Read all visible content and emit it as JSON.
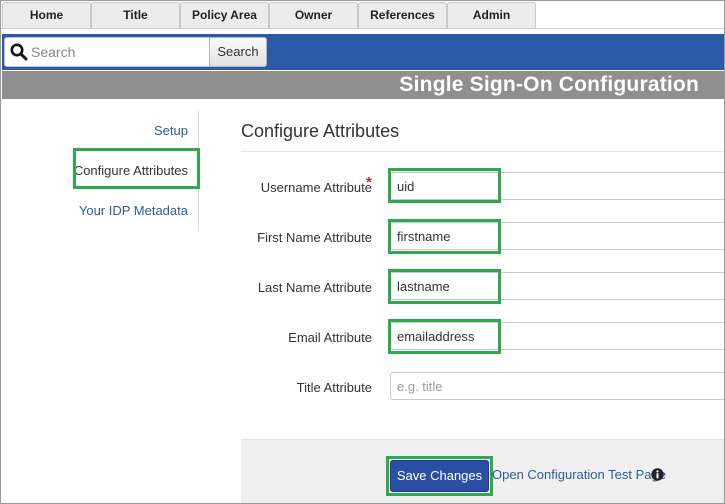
{
  "tabs": [
    {
      "label": "Home"
    },
    {
      "label": "Title"
    },
    {
      "label": "Policy Area"
    },
    {
      "label": "Owner"
    },
    {
      "label": "References"
    },
    {
      "label": "Admin"
    }
  ],
  "search": {
    "placeholder": "Search",
    "button_label": "Search",
    "icon": "search-icon"
  },
  "page": {
    "title": "Single Sign-On Configuration"
  },
  "sidebar": {
    "items": [
      {
        "label": "Setup"
      },
      {
        "label": "Configure Attributes",
        "active": true
      },
      {
        "label": "Your IDP Metadata"
      }
    ]
  },
  "main": {
    "section_title": "Configure Attributes",
    "required_marker": "*",
    "fields": [
      {
        "label": "Username Attribute",
        "value": "uid",
        "required": true
      },
      {
        "label": "First Name Attribute",
        "value": "firstname"
      },
      {
        "label": "Last Name Attribute",
        "value": "lastname"
      },
      {
        "label": "Email Attribute",
        "value": "emailaddress"
      },
      {
        "label": "Title Attribute",
        "value": "",
        "placeholder": "e.g. title"
      }
    ]
  },
  "footer": {
    "save_label": "Save Changes",
    "test_link_label": "Open Configuration Test Page",
    "info_icon": "info-icon"
  },
  "colors": {
    "search_bar": "#2d5aa8",
    "title_bar": "#8f8f8f",
    "highlight": "#2fa84f",
    "primary_button": "#2c4fa6",
    "link": "#2b5d9b",
    "required": "#c0262c"
  }
}
